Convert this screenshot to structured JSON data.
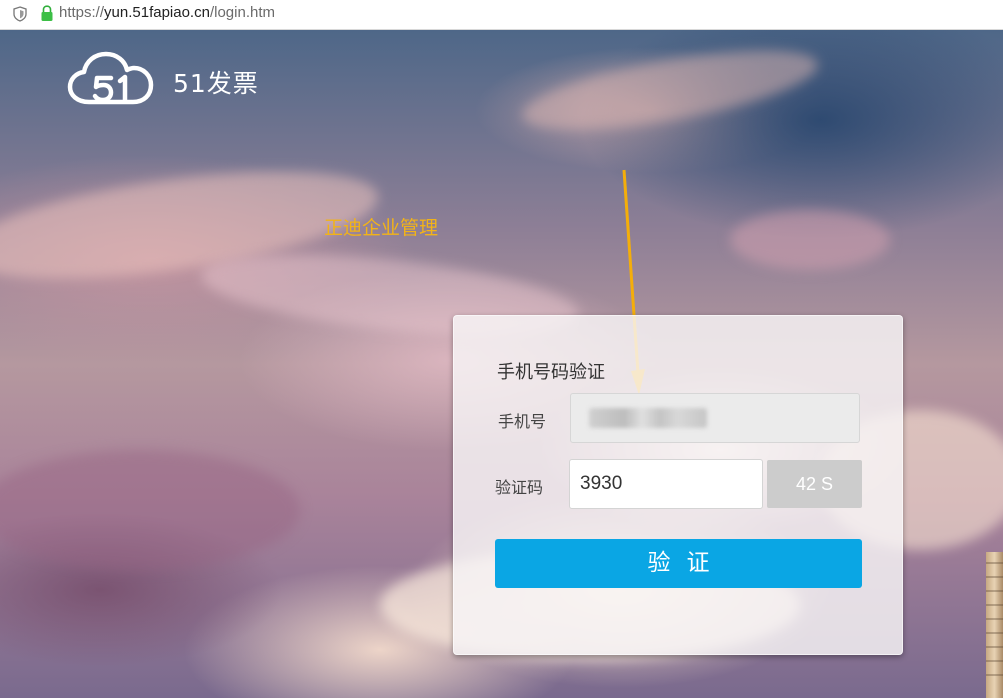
{
  "browser": {
    "url_protocol": "https://",
    "url_host": "yun.51fapiao.cn",
    "url_path": "/login.htm"
  },
  "brand": {
    "logo_text": "51",
    "name": "51发票"
  },
  "annotation": {
    "text": "正迪企业管理",
    "color": "#f2b318"
  },
  "login": {
    "title": "手机号码验证",
    "phone_label": "手机号",
    "phone_value": "",
    "code_label": "验证码",
    "code_value": "3930",
    "countdown": "42 S",
    "submit_label": "验证"
  },
  "colors": {
    "accent": "#0aa6e4",
    "countdown_bg": "#cccccc"
  },
  "icons": [
    "shield-icon",
    "lock-icon",
    "cloud-logo-icon",
    "arrow-icon"
  ]
}
